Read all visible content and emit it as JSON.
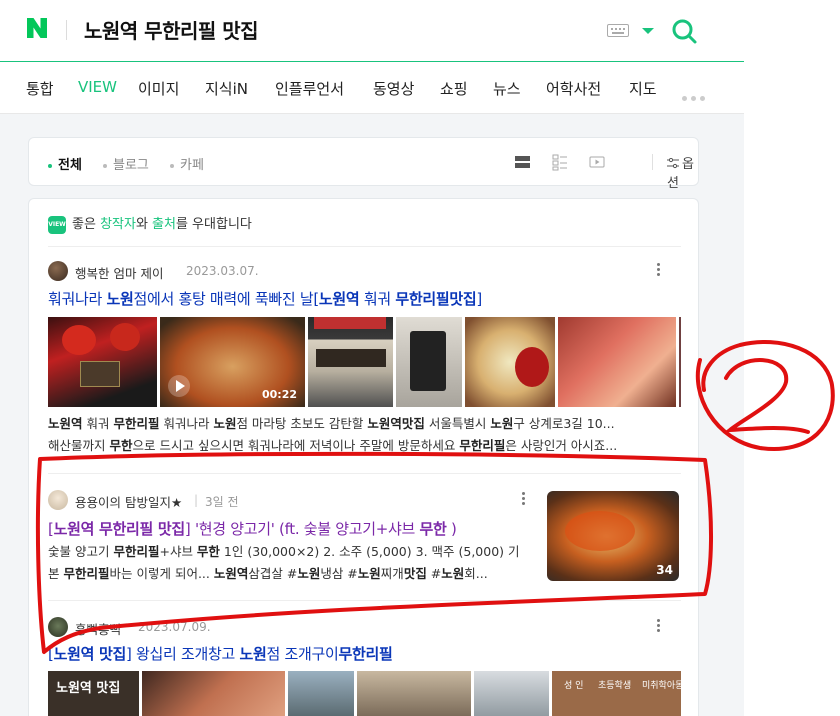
{
  "header": {
    "query": "노원역 무한리필 맛집",
    "logo_letter": "N",
    "logo_color": "#03c75a",
    "accent": "#19c37d"
  },
  "tabs": [
    "통합",
    "VIEW",
    "이미지",
    "지식iN",
    "인플루언서",
    "동영상",
    "쇼핑",
    "뉴스",
    "어학사전",
    "지도"
  ],
  "active_tab": "VIEW",
  "filters": {
    "items": [
      "전체",
      "블로그",
      "카페"
    ],
    "options_label": "옵션"
  },
  "banner": {
    "badge": "VIEW",
    "text_pre": "좋은 ",
    "creator": "창작자",
    "text_mid": "와 ",
    "source": "출처",
    "text_post": "를 우대합니다"
  },
  "posts": [
    {
      "author": "행복한 엄마 제이",
      "date": "2023.03.07.",
      "title_parts": [
        "훠궈나라 ",
        "노원",
        "점에서 홍탕 매력에 푹빠진 날[",
        "노원역",
        " 훠궈 ",
        "무한리필맛집",
        "]"
      ],
      "video_duration": "00:22",
      "desc_line1_parts": [
        "노원역",
        " 훠궈 ",
        "무한리필",
        " 훠궈나라 ",
        "노원",
        "점 마라탕 초보도 감탄할 ",
        "노원역맛집",
        " 서울특별시 ",
        "노원",
        "구 상계로3길 10..."
      ],
      "desc_line2_parts": [
        "해산물까지 ",
        "무한",
        "으로 드시고 싶으시면 훠궈나라에 저녁이나 주말에 방문하세요 ",
        "무한리필",
        "은 사랑인거 아시죠..."
      ]
    },
    {
      "author": "용용이의 탐방일지★",
      "date": "3일 전",
      "title_parts": [
        "[",
        "노원역 무한리필 맛집",
        "] '현경 양고기' (ft. 숯불 양고기+샤브 ",
        "무한",
        " )"
      ],
      "photo_count": "34",
      "desc_line1_parts": [
        "숯불 양고기 ",
        "무한리필",
        "+샤브 ",
        "무한",
        " 1인 (30,000×2) 2. 소주 (5,000) 3. 맥주 (5,000) 기"
      ],
      "desc_line2_parts": [
        "본 ",
        "무한리필",
        "바는 이렇게 되어... ",
        "노원역",
        "삼겹살 #",
        "노원",
        "냉삼 #",
        "노원",
        "찌개",
        "맛집",
        " #",
        "노원",
        "회..."
      ]
    },
    {
      "author": "흥뻑흥뻑",
      "date": "2023.07.09.",
      "title_parts": [
        "[",
        "노원역 맛집",
        "] 왕십리 조개창고 ",
        "노원",
        "점 조개구이",
        "무한리필"
      ],
      "thumb_texts": [
        "노원역 맛집",
        "성 인",
        "초등학생",
        "미취학아동"
      ]
    }
  ],
  "annotation": {
    "marker_label": "2",
    "color": "#e01010"
  }
}
